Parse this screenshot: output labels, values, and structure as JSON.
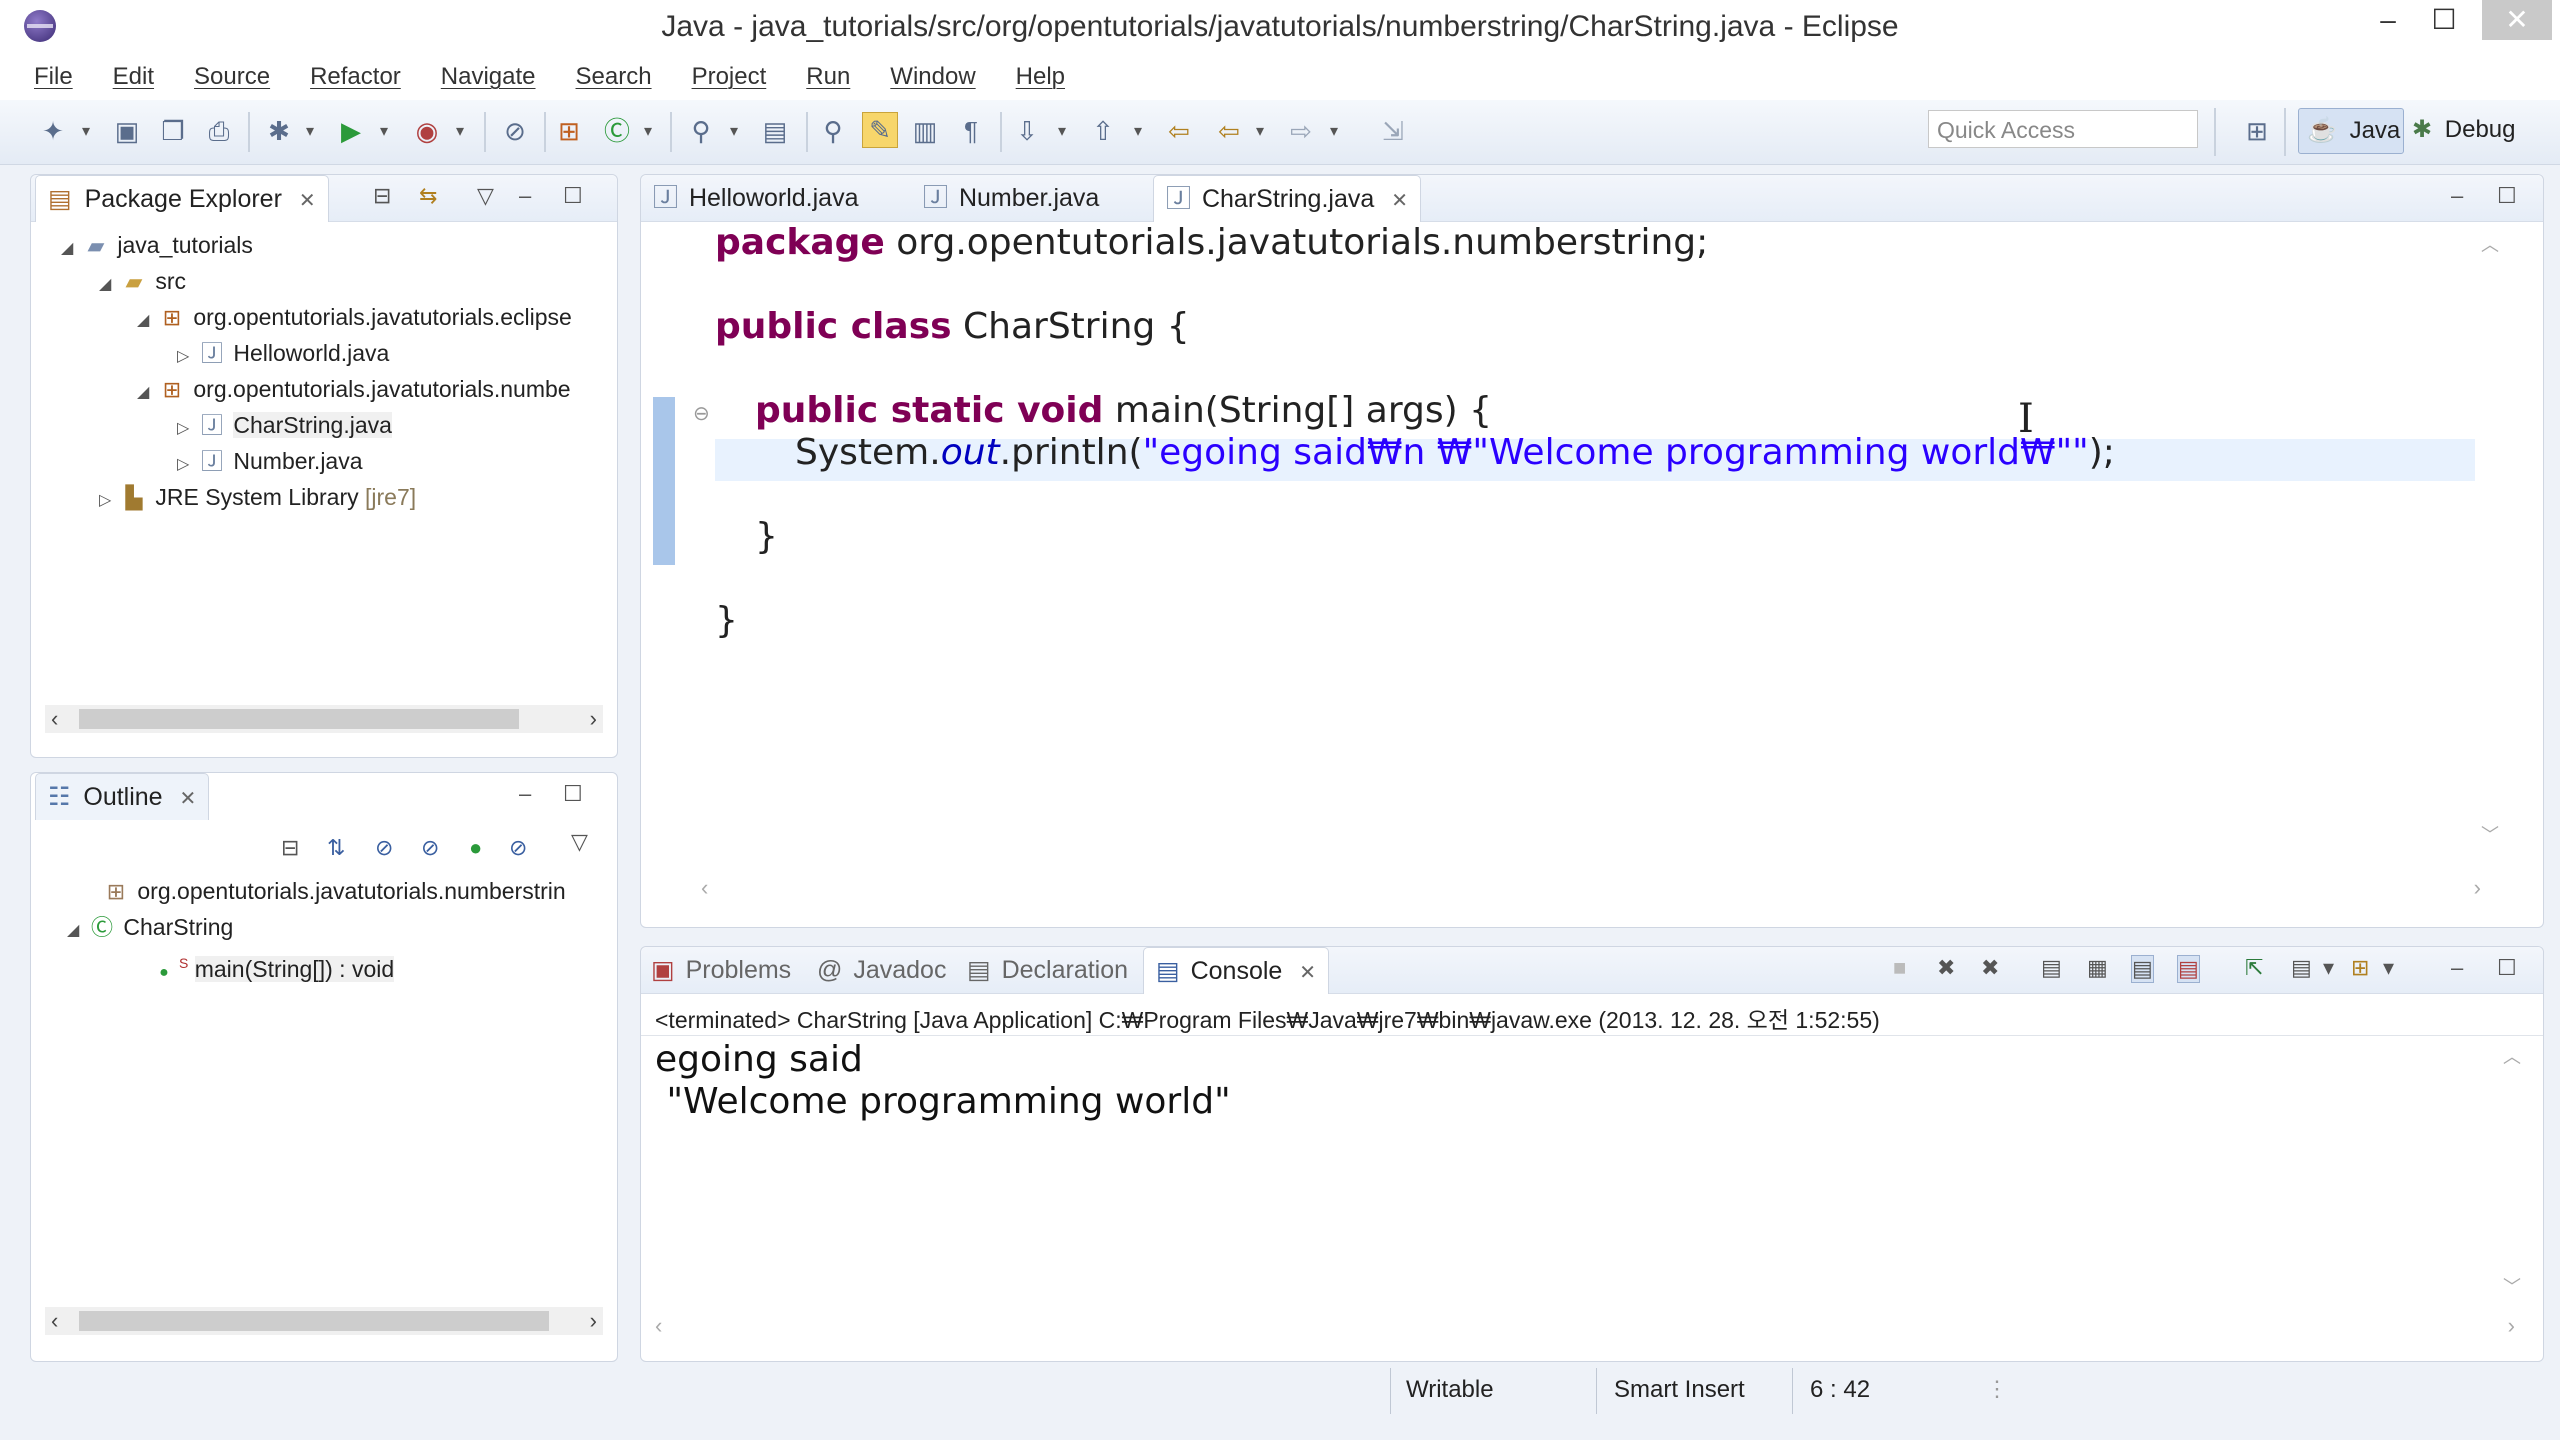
{
  "window": {
    "title": "Java - java_tutorials/src/org/opentutorials/javatutorials/numberstring/CharString.java - Eclipse",
    "minimize": "–",
    "maximize": "☐",
    "close": "✕"
  },
  "menu": [
    "File",
    "Edit",
    "Source",
    "Refactor",
    "Navigate",
    "Search",
    "Project",
    "Run",
    "Window",
    "Help"
  ],
  "toolbar": {
    "quick_access_placeholder": "Quick Access",
    "perspective_java": "Java",
    "perspective_debug": "Debug"
  },
  "package_explorer": {
    "title": "Package Explorer",
    "tree": [
      {
        "label": "java_tutorials",
        "icon": "project-folder-icon"
      },
      {
        "label": "src",
        "icon": "source-folder-icon"
      },
      {
        "label": "org.opentutorials.javatutorials.eclipse",
        "icon": "package-icon"
      },
      {
        "label": "Helloworld.java",
        "icon": "java-file-icon"
      },
      {
        "label": "org.opentutorials.javatutorials.numbe",
        "icon": "package-icon"
      },
      {
        "label": "CharString.java",
        "icon": "java-file-icon"
      },
      {
        "label": "Number.java",
        "icon": "java-file-icon"
      },
      {
        "label": "JRE System Library",
        "icon": "library-icon",
        "suffix": "[jre7]"
      }
    ]
  },
  "outline": {
    "title": "Outline",
    "tree": [
      {
        "label": "org.opentutorials.javatutorials.numberstrin",
        "icon": "package-icon"
      },
      {
        "label": "CharString",
        "icon": "class-icon"
      },
      {
        "label": "main(String[]) : void",
        "icon": "method-icon",
        "badge": "S"
      }
    ]
  },
  "editor": {
    "tabs": [
      "Helloworld.java",
      "Number.java",
      "CharString.java"
    ],
    "active_tab": "CharString.java",
    "code": {
      "l1_kw": "package",
      "l1_rest": " org.opentutorials.javatutorials.numberstring;",
      "l2_kw": "public class",
      "l2_rest": " CharString {",
      "l3_kw": "public static void",
      "l3_rest": " main(String[] args) {",
      "l4_a": "System.",
      "l4_b": "out",
      "l4_c": ".println(",
      "l4_str": "\"egoing said₩n ₩\"Welcome programming world₩\"\"",
      "l4_end": ");",
      "l5": "}",
      "l6": "}"
    }
  },
  "bottom_panel": {
    "tabs": [
      "Problems",
      "Javadoc",
      "Declaration",
      "Console"
    ],
    "active_tab": "Console",
    "status_line": "<terminated> CharString [Java Application] C:₩Program Files₩Java₩jre7₩bin₩javaw.exe (2013. 12. 28. 오전 1:52:55)",
    "output": [
      "egoing said",
      " \"Welcome programming world\""
    ]
  },
  "status_bar": {
    "writable": "Writable",
    "insert_mode": "Smart Insert",
    "position": "6 : 42"
  }
}
